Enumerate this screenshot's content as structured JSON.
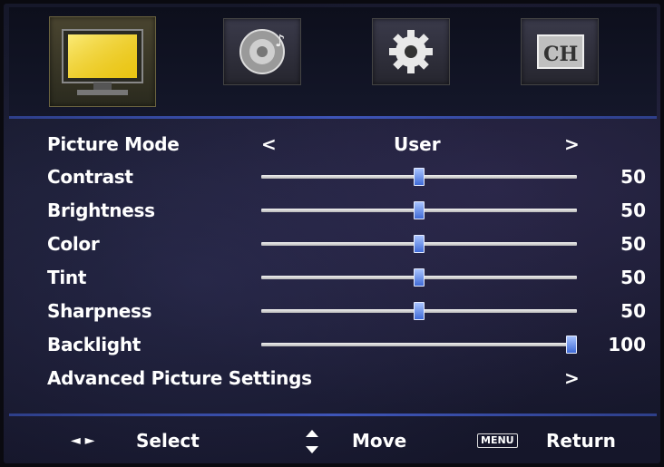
{
  "tabs": [
    {
      "icon": "tv-picture-icon",
      "active": true
    },
    {
      "icon": "sound-speaker-icon",
      "active": false
    },
    {
      "icon": "settings-gear-icon",
      "active": false
    },
    {
      "icon": "channel-ch-icon",
      "active": false
    }
  ],
  "picture_mode": {
    "label": "Picture Mode",
    "value": "User",
    "left_arrow": "<",
    "right_arrow": ">"
  },
  "settings": [
    {
      "label": "Contrast",
      "value": "50",
      "level": 0.5
    },
    {
      "label": "Brightness",
      "value": "50",
      "level": 0.5
    },
    {
      "label": "Color",
      "value": "50",
      "level": 0.5
    },
    {
      "label": "Tint",
      "value": "50",
      "level": 0.5
    },
    {
      "label": "Sharpness",
      "value": "50",
      "level": 0.5
    },
    {
      "label": "Backlight",
      "value": "100",
      "level": 1.0
    }
  ],
  "advanced": {
    "label": "Advanced Picture Settings",
    "arrow": ">"
  },
  "footer": {
    "select_arrows": "◄ ►",
    "select_label": "Select",
    "move_label": "Move",
    "menu_key": "MENU",
    "return_label": "Return"
  },
  "colors": {
    "accent_blue": "#3e55b8",
    "slider_thumb": "#3f6bd6",
    "tv_screen_yellow": "#f2d21a"
  }
}
